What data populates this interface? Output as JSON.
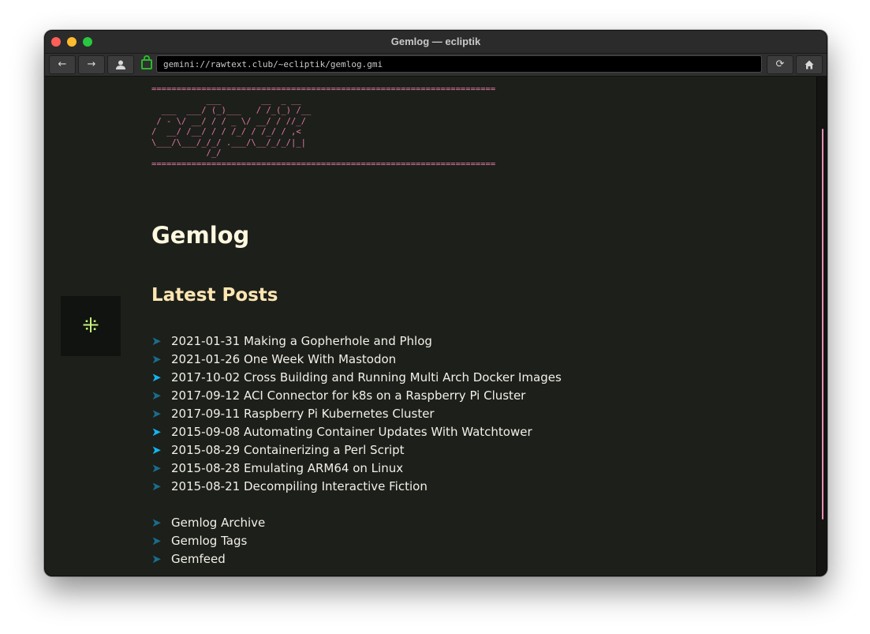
{
  "window": {
    "title": "Gemlog — ecliptik"
  },
  "toolbar": {
    "back_icon": "←",
    "forward_icon": "→",
    "identity_icon": "👤",
    "reload_icon": "⟳",
    "home_icon": "⌂",
    "url": "gemini://rawtext.club/~ecliptik/gemlog.gmi"
  },
  "page": {
    "ascii_art": "=====================================================================\n           ___        __  _ __\n  ___  ___/ (_)___   / /_(_) /__\n / - \\/ __/ / / _ \\/ __/ / //_/\n/  __/ /__/ / / /_/ / /_/ / ,<\n\\___/\\___/_/_/ .___/\\__/_/_/|_|\n           /_/\n=====================================================================",
    "heading": "Gemlog",
    "subheading": "Latest Posts",
    "side_badge_icon": "⁜",
    "posts": [
      {
        "text": "2021-01-31 Making a Gopherhole and Phlog",
        "visited": false
      },
      {
        "text": "2021-01-26 One Week With Mastodon",
        "visited": false
      },
      {
        "text": "2017-10-02 Cross Building and Running Multi Arch Docker Images",
        "visited": true
      },
      {
        "text": "2017-09-12 ACI Connector for k8s on a Raspberry Pi Cluster",
        "visited": false
      },
      {
        "text": "2017-09-11 Raspberry Pi Kubernetes Cluster",
        "visited": false
      },
      {
        "text": "2015-09-08 Automating Container Updates With Watchtower",
        "visited": true
      },
      {
        "text": "2015-08-29 Containerizing a Perl Script",
        "visited": true
      },
      {
        "text": "2015-08-28 Emulating ARM64 on Linux",
        "visited": false
      },
      {
        "text": "2015-08-21 Decompiling Interactive Fiction",
        "visited": false
      }
    ],
    "nav_links": [
      {
        "text": "Gemlog Archive",
        "visited": false
      },
      {
        "text": "Gemlog Tags",
        "visited": false
      },
      {
        "text": "Gemfeed",
        "visited": false
      }
    ],
    "link_arrow": "➤"
  },
  "colors": {
    "background": "#1d1f1a",
    "ascii": "#e07aa7",
    "heading": "#fff8e0",
    "subheading": "#fde6b3",
    "link_arrow": "#1a6d8e",
    "link_arrow_visited": "#12b5f0",
    "badge_icon": "#c6f27b"
  }
}
